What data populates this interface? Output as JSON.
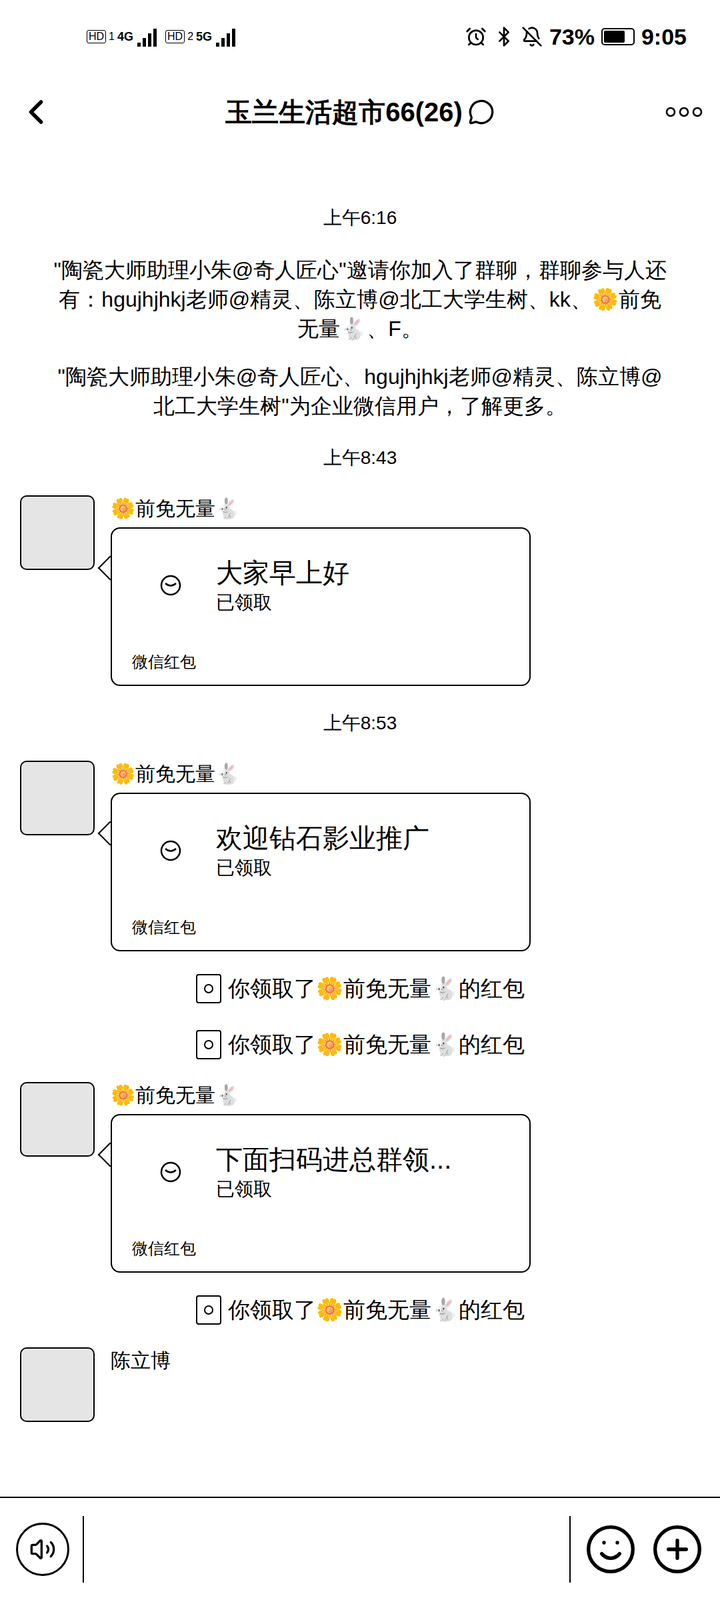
{
  "status_bar": {
    "sims": [
      {
        "hd": "HD",
        "slot": "1",
        "network": "4G"
      },
      {
        "hd": "HD",
        "slot": "2",
        "network": "5G"
      }
    ],
    "battery": {
      "reading": "73%",
      "level": 0.73
    },
    "time": "9:05"
  },
  "header": {
    "title": "玉兰生活超市66(26)"
  },
  "messages": [
    {
      "kind": "time",
      "text": "上午6:16"
    },
    {
      "kind": "system",
      "text": "\"陶瓷大师助理小朱@奇人匠心\"邀请你加入了群聊，群聊参与人还有：hgujhjhkj老师@精灵、陈立博@北工大学生树、kk、🌼前免无量🐇、F。"
    },
    {
      "kind": "system",
      "text": "\"陶瓷大师助理小朱@奇人匠心、hgujhjhkj老师@精灵、陈立博@北工大学生树\"为企业微信用户，了解更多。"
    },
    {
      "kind": "time",
      "text": "上午8:43"
    },
    {
      "kind": "redpacket",
      "sender": "🌼前免无量🐇",
      "title": "大家早上好",
      "status": "已领取",
      "label": "微信红包"
    },
    {
      "kind": "time",
      "text": "上午8:53"
    },
    {
      "kind": "redpacket",
      "sender": "🌼前免无量🐇",
      "title": "欢迎钻石影业推广",
      "status": "已领取",
      "label": "微信红包"
    },
    {
      "kind": "notice",
      "text": "你领取了🌼前免无量🐇的红包"
    },
    {
      "kind": "notice",
      "text": "你领取了🌼前免无量🐇的红包"
    },
    {
      "kind": "redpacket",
      "sender": "🌼前免无量🐇",
      "title": "下面扫码进总群领...",
      "status": "已领取",
      "label": "微信红包"
    },
    {
      "kind": "notice",
      "text": "你领取了🌼前免无量🐇的红包"
    },
    {
      "kind": "partial",
      "sender": "陈立博"
    }
  ]
}
